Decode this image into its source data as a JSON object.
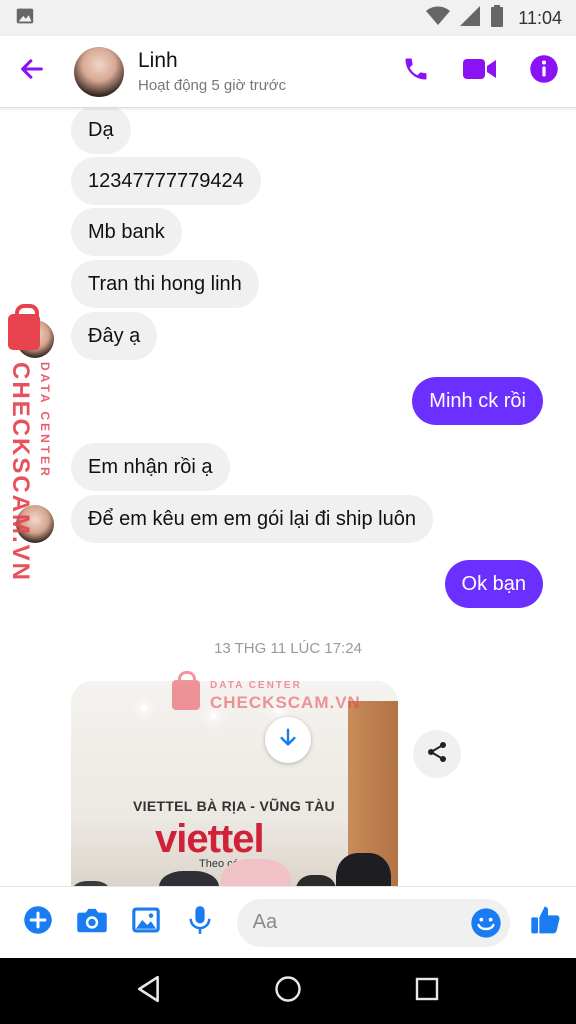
{
  "status_bar": {
    "time": "11:04",
    "icons": [
      "image-icon",
      "wifi-icon",
      "signal-icon",
      "battery-icon"
    ]
  },
  "header": {
    "name": "Linh",
    "status": "Hoạt động 5 giờ trước",
    "icons": {
      "back": "back-arrow-icon",
      "call": "phone-icon",
      "video": "video-call-icon",
      "info": "info-icon"
    }
  },
  "messages": [
    {
      "text": "Dạ",
      "dir": "in"
    },
    {
      "text": "12347777779424",
      "dir": "in"
    },
    {
      "text": "Mb bank",
      "dir": "in"
    },
    {
      "text": "Tran thi hong linh",
      "dir": "in"
    },
    {
      "text": "Đây ạ",
      "dir": "in"
    },
    {
      "text": "Minh ck rồi",
      "dir": "out"
    },
    {
      "text": "Em nhận rồi ạ",
      "dir": "in"
    },
    {
      "text": "Để em kêu em em gói lại đi ship luôn",
      "dir": "in"
    },
    {
      "text": "Ok bạn",
      "dir": "out"
    }
  ],
  "timestamp": "13 THG 11 LÚC 17:24",
  "photo": {
    "caption": "VIETTEL BÀ RỊA - VŨNG TÀU",
    "logo_text": "viettel",
    "tagline": "Theo cách"
  },
  "watermark": {
    "sub": "DATA CENTER",
    "brand": "CHECKSCAM.VN"
  },
  "composer": {
    "placeholder": "Aa",
    "icons": [
      "plus-icon",
      "camera-icon",
      "gallery-icon",
      "microphone-icon",
      "emoji-icon",
      "thumbs-up-icon"
    ]
  },
  "colors": {
    "accent": "#8a12f5",
    "outgoing": "#6b30ff",
    "incoming": "#f0f0f0",
    "watermark": "#e7434f",
    "link_blue": "#1a7cf2"
  }
}
